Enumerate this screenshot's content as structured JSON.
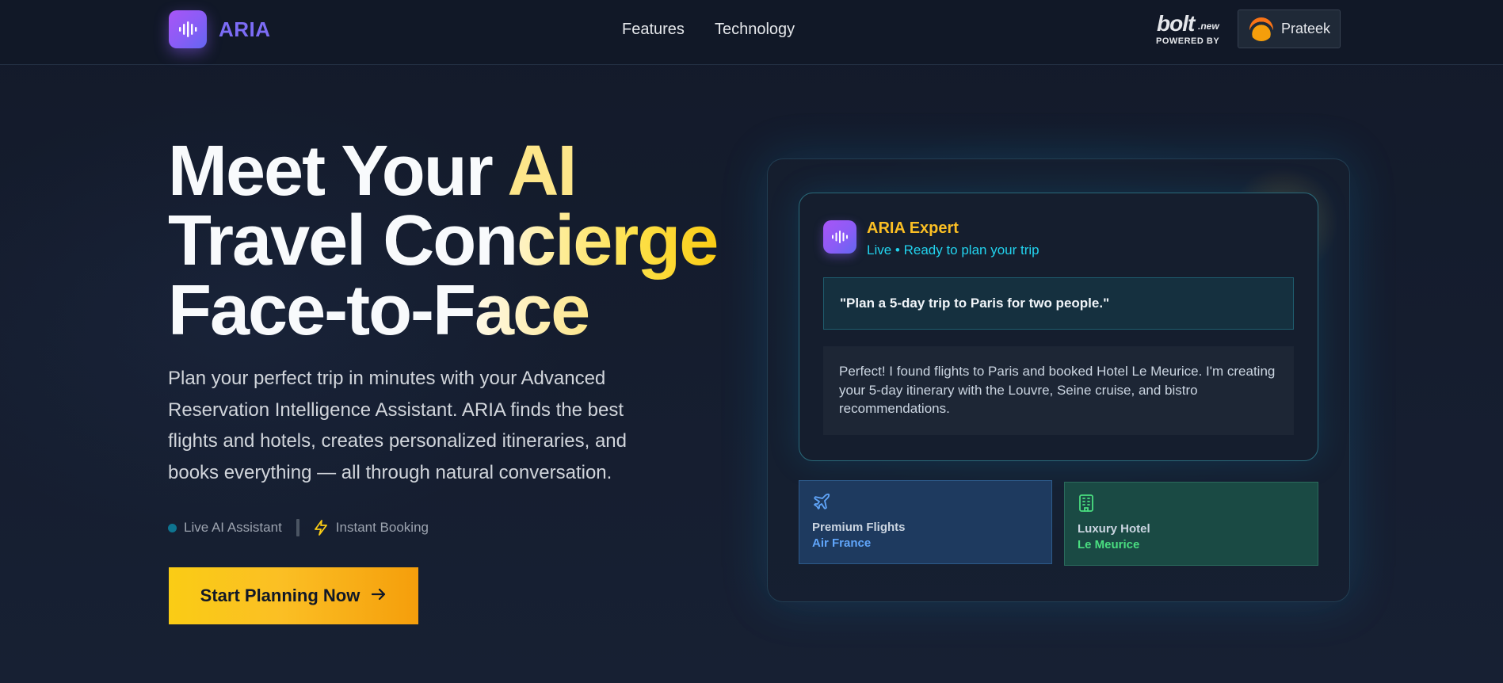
{
  "nav": {
    "brand": "ARIA",
    "links": [
      {
        "label": "Features"
      },
      {
        "label": "Technology"
      }
    ],
    "partner": {
      "word": "bolt",
      "suffix": ".new",
      "tagline": "POWERED BY"
    },
    "user": {
      "name": "Prateek"
    }
  },
  "hero": {
    "title_line1_a": "Meet Your ",
    "title_line1_b": "AI",
    "title_line2_a": "Travel Con",
    "title_line2_b": "cierge",
    "title_line3_a": "Face-to-F",
    "title_line3_b": "ace",
    "subtitle": "Plan your perfect trip in minutes with your Advanced Reservation Intelligence Assistant. ARIA finds the best flights and hotels, creates personalized itineraries, and books everything — all through natural conversation.",
    "badge_live": "Live AI Assistant",
    "badge_booking": "Instant Booking",
    "cta_label": "Start Planning Now"
  },
  "chat": {
    "agent_name": "ARIA Expert",
    "agent_status": "Live • Ready to plan your trip",
    "user_message": "\"Plan a 5-day trip to Paris for two people.\"",
    "agent_message": "Perfect! I found flights to Paris and booked Hotel Le Meurice. I'm creating your 5-day itinerary with the Louvre, Seine cruise, and bistro recommendations."
  },
  "tiles": {
    "flight": {
      "label": "Premium Flights",
      "value": "Air France",
      "icon": "plane-icon"
    },
    "hotel": {
      "label": "Luxury Hotel",
      "value": "Le Meurice",
      "icon": "building-icon"
    }
  },
  "colors": {
    "accent_gold": "#facc15",
    "accent_purple": "#8b5cf6",
    "accent_cyan": "#22d3ee",
    "background": "#141b2c"
  }
}
